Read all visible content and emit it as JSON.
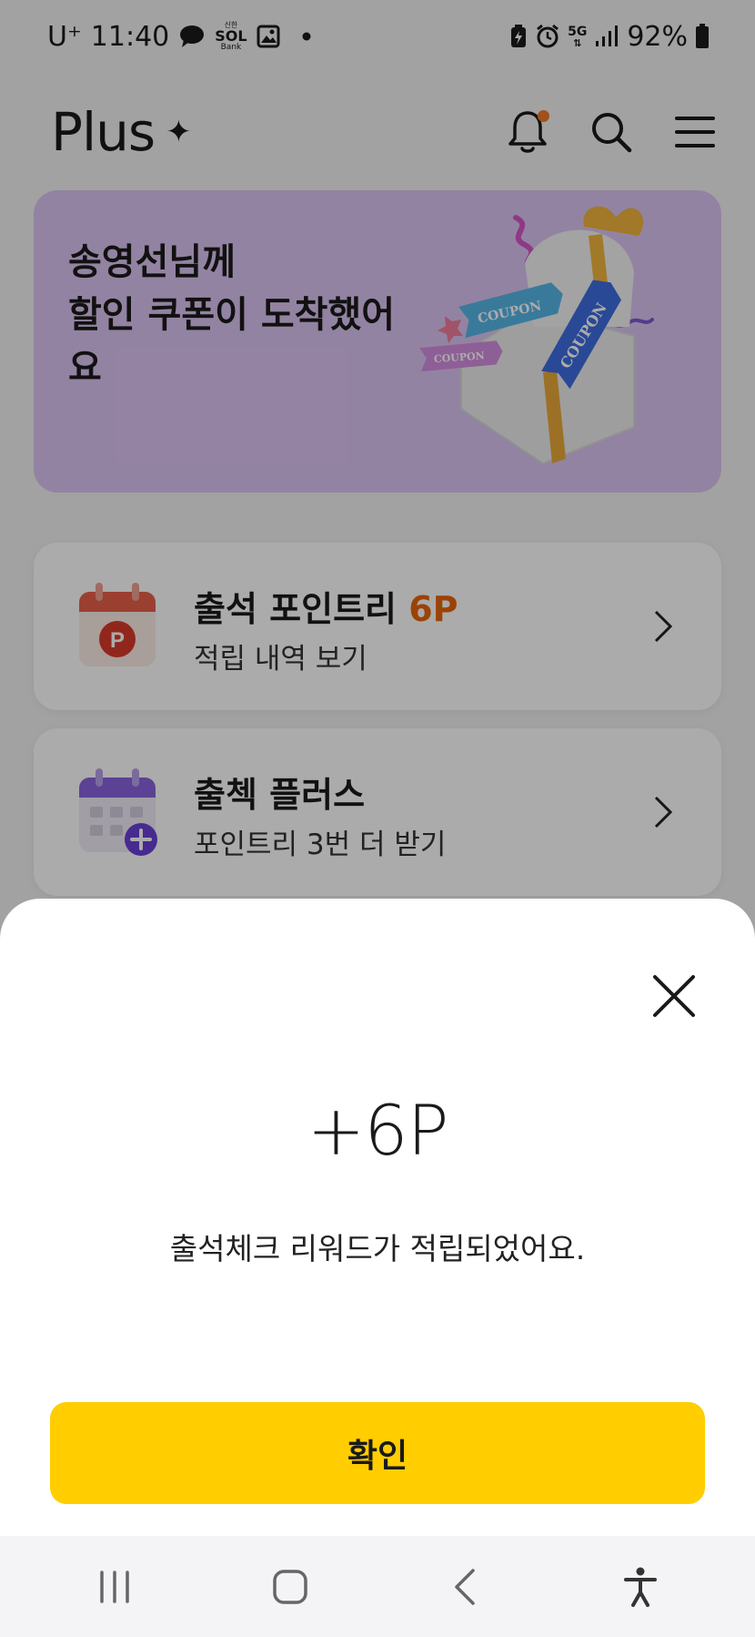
{
  "status_bar": {
    "carrier": "U⁺",
    "time": "11:40",
    "bank_badge_small": "신한",
    "bank_badge_main": "SOL",
    "bank_badge_sub": "Bank",
    "network": "5G",
    "battery": "92%"
  },
  "header": {
    "logo_text": "Plus",
    "logo_spark": "✦"
  },
  "banner": {
    "text": "송영선님께\n할인 쿠폰이 도착했어\n요",
    "coupon_label": "COUPON"
  },
  "cards": [
    {
      "title": "출석 포인트리 ",
      "title_accent": "6P",
      "subtitle": "적립 내역 보기",
      "icon_letter": "P"
    },
    {
      "title": "출첵 플러스",
      "subtitle": "포인트리 3번 더 받기"
    }
  ],
  "sheet": {
    "points": "+6P",
    "message": "출석체크 리워드가 적립되었어요.",
    "confirm_label": "확인"
  },
  "colors": {
    "accent_orange": "#e8650a",
    "confirm_yellow": "#ffcd00",
    "banner_purple": "#dcc3f2",
    "notification_dot": "#f07a26"
  }
}
